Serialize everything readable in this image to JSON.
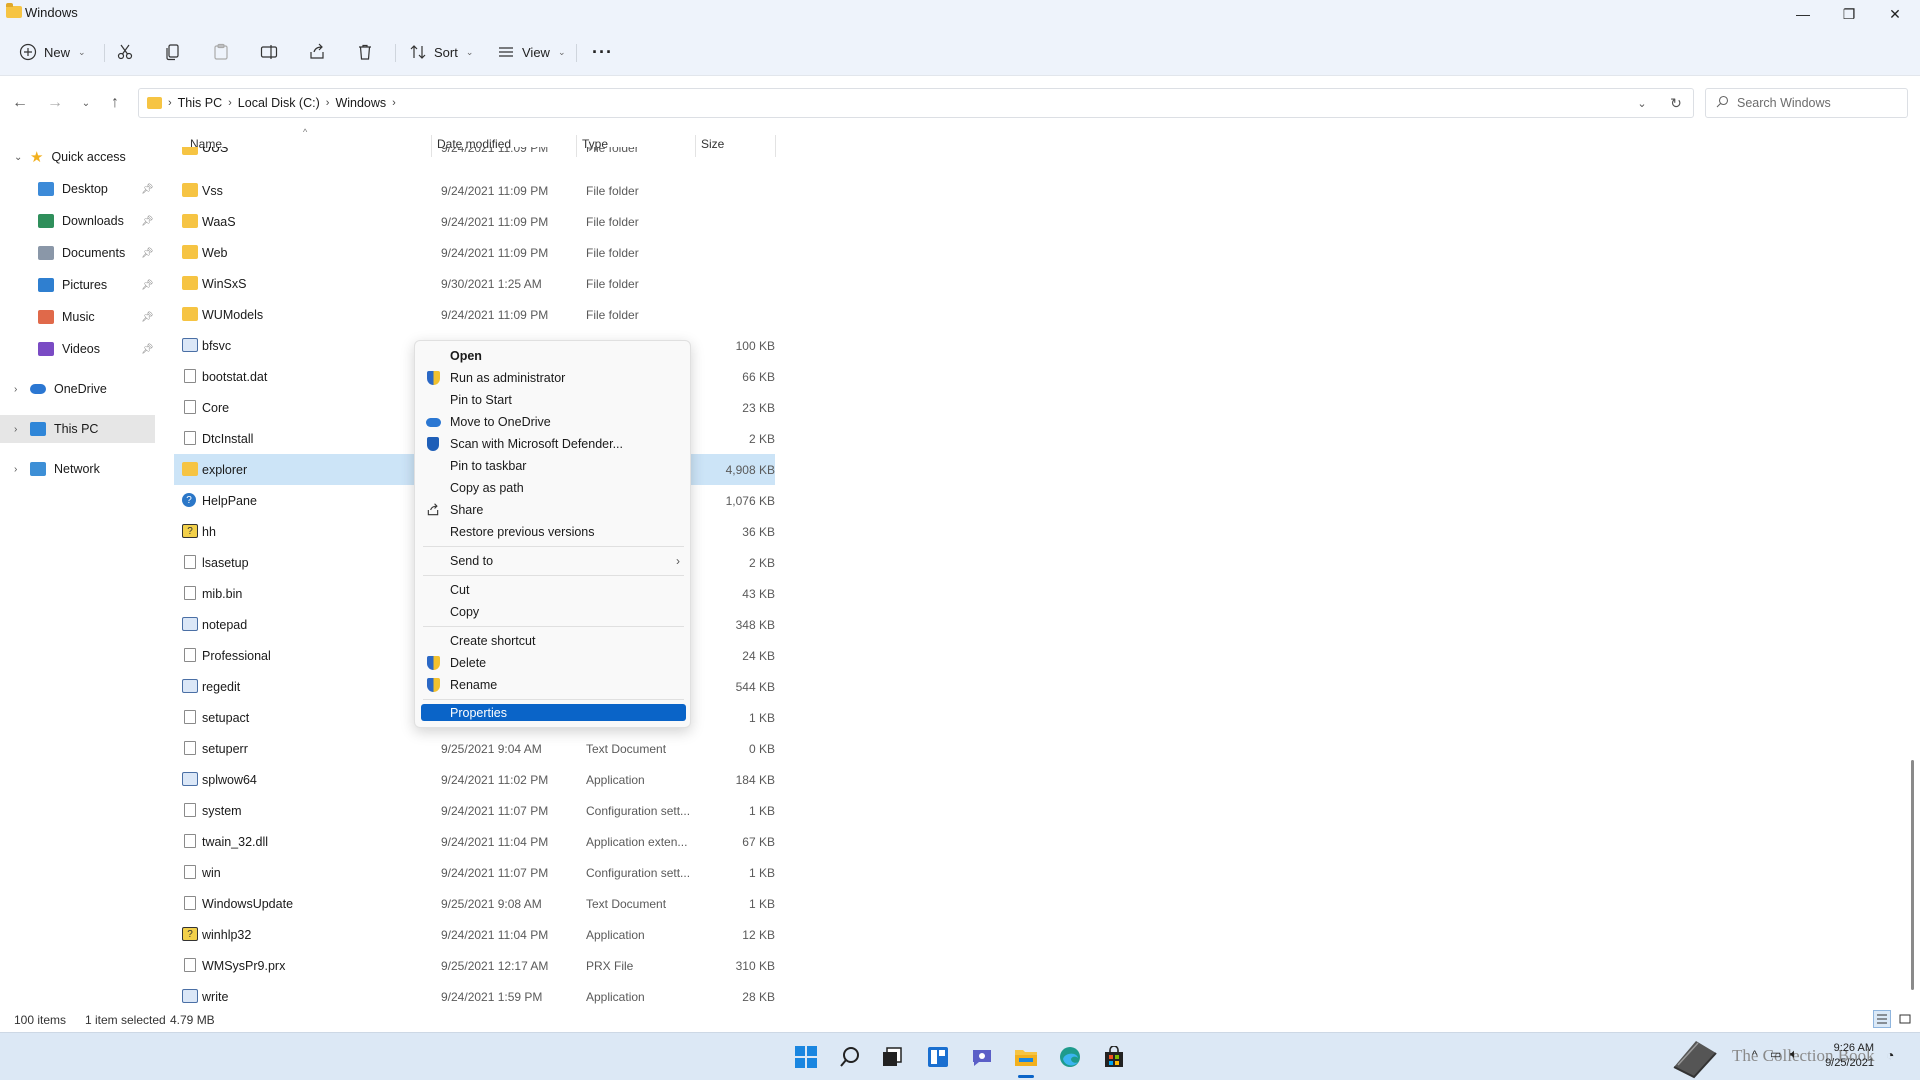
{
  "window": {
    "title": "Windows",
    "controls": {
      "minimize": "—",
      "maximize": "❐",
      "close": "✕"
    }
  },
  "toolbar": {
    "new_label": "New",
    "sort_label": "Sort",
    "view_label": "View",
    "more_label": "···"
  },
  "address": {
    "crumbs": [
      "This PC",
      "Local Disk (C:)",
      "Windows"
    ],
    "search_placeholder": "Search Windows"
  },
  "navpane": {
    "quick_access": "Quick access",
    "items": [
      {
        "label": "Desktop",
        "icon": "desktop-icon",
        "color": "#3c8ad8"
      },
      {
        "label": "Downloads",
        "icon": "download-icon",
        "color": "#2f8f5b"
      },
      {
        "label": "Documents",
        "icon": "documents-icon",
        "color": "#8a97a8"
      },
      {
        "label": "Pictures",
        "icon": "pictures-icon",
        "color": "#2f7fd0"
      },
      {
        "label": "Music",
        "icon": "music-icon",
        "color": "#e0694a"
      },
      {
        "label": "Videos",
        "icon": "videos-icon",
        "color": "#7a4bc4"
      }
    ],
    "onedrive": "OneDrive",
    "this_pc": "This PC",
    "network": "Network"
  },
  "columns": {
    "name": "Name",
    "date": "Date modified",
    "type": "Type",
    "size": "Size"
  },
  "files": [
    {
      "name": "UUS",
      "date": "9/24/2021 11:09 PM",
      "type": "File folder",
      "size": "",
      "kind": "folder"
    },
    {
      "name": "Vss",
      "date": "9/24/2021 11:09 PM",
      "type": "File folder",
      "size": "",
      "kind": "folder"
    },
    {
      "name": "WaaS",
      "date": "9/24/2021 11:09 PM",
      "type": "File folder",
      "size": "",
      "kind": "folder"
    },
    {
      "name": "Web",
      "date": "9/24/2021 11:09 PM",
      "type": "File folder",
      "size": "",
      "kind": "folder"
    },
    {
      "name": "WinSxS",
      "date": "9/30/2021 1:25 AM",
      "type": "File folder",
      "size": "",
      "kind": "folder"
    },
    {
      "name": "WUModels",
      "date": "9/24/2021 11:09 PM",
      "type": "File folder",
      "size": "",
      "kind": "folder"
    },
    {
      "name": "bfsvc",
      "date": "",
      "type": "",
      "size": "100 KB",
      "kind": "app"
    },
    {
      "name": "bootstat.dat",
      "date": "",
      "type": "",
      "size": "66 KB",
      "kind": "doc"
    },
    {
      "name": "Core",
      "date": "",
      "type": "",
      "size": "23 KB",
      "kind": "doc"
    },
    {
      "name": "DtcInstall",
      "date": "",
      "type": "",
      "size": "2 KB",
      "kind": "doc"
    },
    {
      "name": "explorer",
      "date": "",
      "type": "",
      "size": "4,908 KB",
      "kind": "folder",
      "selected": true
    },
    {
      "name": "HelpPane",
      "date": "",
      "type": "",
      "size": "1,076 KB",
      "kind": "help"
    },
    {
      "name": "hh",
      "date": "",
      "type": "",
      "size": "36 KB",
      "kind": "hh"
    },
    {
      "name": "lsasetup",
      "date": "",
      "type": "",
      "size": "2 KB",
      "kind": "doc"
    },
    {
      "name": "mib.bin",
      "date": "",
      "type": "",
      "size": "43 KB",
      "kind": "doc"
    },
    {
      "name": "notepad",
      "date": "",
      "type": "",
      "size": "348 KB",
      "kind": "app"
    },
    {
      "name": "Professional",
      "date": "",
      "type": "",
      "size": "24 KB",
      "kind": "doc"
    },
    {
      "name": "regedit",
      "date": "",
      "type": "",
      "size": "544 KB",
      "kind": "app"
    },
    {
      "name": "setupact",
      "date": "",
      "type": "",
      "size": "1 KB",
      "kind": "doc"
    },
    {
      "name": "setuperr",
      "date": "9/25/2021 9:04 AM",
      "type": "Text Document",
      "size": "0 KB",
      "kind": "doc"
    },
    {
      "name": "splwow64",
      "date": "9/24/2021 11:02 PM",
      "type": "Application",
      "size": "184 KB",
      "kind": "app"
    },
    {
      "name": "system",
      "date": "9/24/2021 11:07 PM",
      "type": "Configuration sett...",
      "size": "1 KB",
      "kind": "doc"
    },
    {
      "name": "twain_32.dll",
      "date": "9/24/2021 11:04 PM",
      "type": "Application exten...",
      "size": "67 KB",
      "kind": "doc"
    },
    {
      "name": "win",
      "date": "9/24/2021 11:07 PM",
      "type": "Configuration sett...",
      "size": "1 KB",
      "kind": "doc"
    },
    {
      "name": "WindowsUpdate",
      "date": "9/25/2021 9:08 AM",
      "type": "Text Document",
      "size": "1 KB",
      "kind": "doc"
    },
    {
      "name": "winhlp32",
      "date": "9/24/2021 11:04 PM",
      "type": "Application",
      "size": "12 KB",
      "kind": "hh"
    },
    {
      "name": "WMSysPr9.prx",
      "date": "9/25/2021 12:17 AM",
      "type": "PRX File",
      "size": "310 KB",
      "kind": "doc"
    },
    {
      "name": "write",
      "date": "9/24/2021 1:59 PM",
      "type": "Application",
      "size": "28 KB",
      "kind": "app"
    }
  ],
  "context_menu": {
    "open": "Open",
    "run_admin": "Run as administrator",
    "pin_start": "Pin to Start",
    "move_onedrive": "Move to OneDrive",
    "scan_defender": "Scan with Microsoft Defender...",
    "pin_taskbar": "Pin to taskbar",
    "copy_path": "Copy as path",
    "share": "Share",
    "restore_versions": "Restore previous versions",
    "send_to": "Send to",
    "cut": "Cut",
    "copy": "Copy",
    "create_shortcut": "Create shortcut",
    "delete": "Delete",
    "rename": "Rename",
    "properties": "Properties"
  },
  "status": {
    "item_count": "100 items",
    "selection": "1 item selected",
    "selection_size": "4.79 MB"
  },
  "taskbar": {
    "time": "9:26 AM",
    "date": "9/25/2021",
    "watermark": "The Collection Book"
  },
  "colors": {
    "accent": "#0a64c8",
    "selection": "#cce4f7",
    "folder": "#f6c443"
  }
}
